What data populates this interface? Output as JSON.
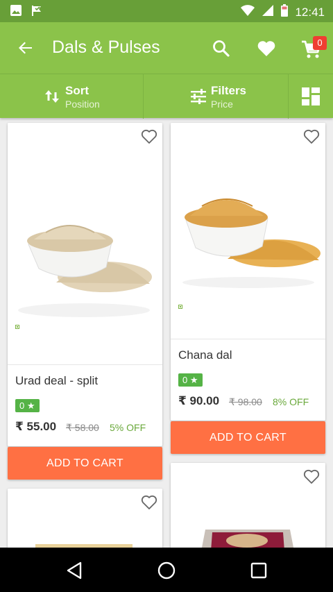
{
  "status_bar": {
    "time": "12:41",
    "left_icons": [
      "image-icon",
      "flag-icon"
    ],
    "right_icons": [
      "wifi-icon",
      "signal-icon",
      "battery-icon"
    ]
  },
  "app_bar": {
    "title": "Dals & Pulses",
    "cart_count": "0",
    "icons": [
      "back-arrow-icon",
      "search-icon",
      "heart-icon",
      "cart-icon"
    ]
  },
  "toolbar": {
    "sort_label": "Sort",
    "sort_value": "Position",
    "filter_label": "Filters",
    "filter_value": "Price",
    "view_icon": "grid-view-icon"
  },
  "products": [
    {
      "name": "Urad deal - split",
      "rating": "0 ★",
      "price": "₹ 55.00",
      "mrp": "₹ 58.00",
      "discount": "5% OFF",
      "button": "ADD TO CART"
    },
    {
      "name": "Chana dal",
      "rating": "0 ★",
      "price": "₹ 90.00",
      "mrp": "₹ 98.00",
      "discount": "8% OFF",
      "button": "ADD TO CART"
    }
  ],
  "colors": {
    "primary": "#8bc34a",
    "primary_dark": "#689f38",
    "accent": "#ff7043",
    "rating_bg": "#55b346",
    "discount": "#69a83a",
    "badge": "#ef3e32"
  },
  "nav_bar": {
    "icons": [
      "back-nav-icon",
      "home-nav-icon",
      "recents-nav-icon"
    ]
  }
}
